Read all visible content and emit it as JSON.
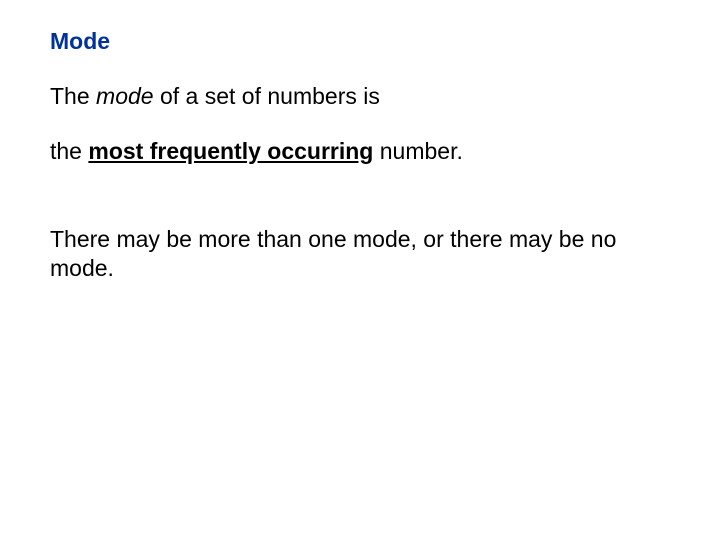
{
  "heading": "Mode",
  "line1_part1": "The ",
  "line1_mode": "mode",
  "line1_part2": " of a set of numbers is",
  "line2_part1": "the ",
  "line2_emph": "most frequently occurring",
  "line2_part2": " number.",
  "line3": "There may be more than one mode, or there may be no mode."
}
